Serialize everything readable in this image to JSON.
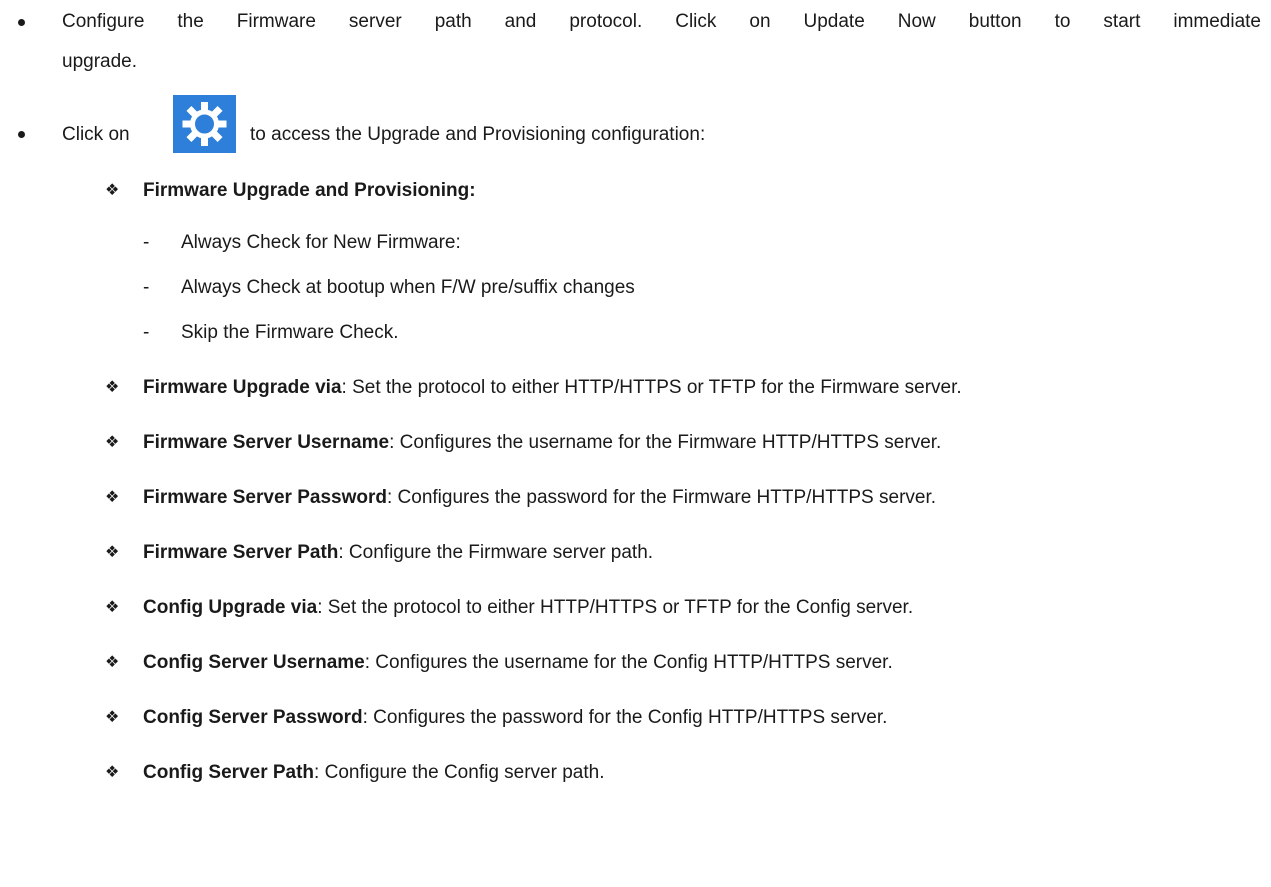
{
  "intro": {
    "line1": "Configure the Firmware server path and protocol. Click on Update Now button to start immediate",
    "line2": "upgrade."
  },
  "access": {
    "click_on": "Click on",
    "gear_icon": "gear-icon",
    "rest": "to access the Upgrade and Provisioning configuration:"
  },
  "provisioning": {
    "heading": "Firmware Upgrade and Provisioning:",
    "options": [
      "Always Check for New Firmware:",
      "Always Check at bootup when F/W pre/suffix changes",
      "Skip the Firmware Check."
    ]
  },
  "items": [
    {
      "term": "Firmware Upgrade via",
      "desc": ": Set the protocol to either HTTP/HTTPS or TFTP for the Firmware server."
    },
    {
      "term": "Firmware Server Username",
      "desc": ": Configures the username for the Firmware HTTP/HTTPS server."
    },
    {
      "term": "Firmware Server Password",
      "desc": ": Configures the password for the Firmware HTTP/HTTPS server."
    },
    {
      "term": "Firmware Server Path",
      "desc": ": Configure the Firmware server path."
    },
    {
      "term": "Config Upgrade via",
      "desc": ": Set the protocol to either HTTP/HTTPS or TFTP for the Config server."
    },
    {
      "term": "Config Server Username",
      "desc": ": Configures the username for the Config HTTP/HTTPS server."
    },
    {
      "term": "Config Server Password",
      "desc": ": Configures the password for the Config HTTP/HTTPS server."
    },
    {
      "term": "Config Server Path",
      "desc": ": Configure the Config server path."
    }
  ],
  "colors": {
    "gear_background": "#2e7fd9",
    "text": "#1a1a1a"
  }
}
